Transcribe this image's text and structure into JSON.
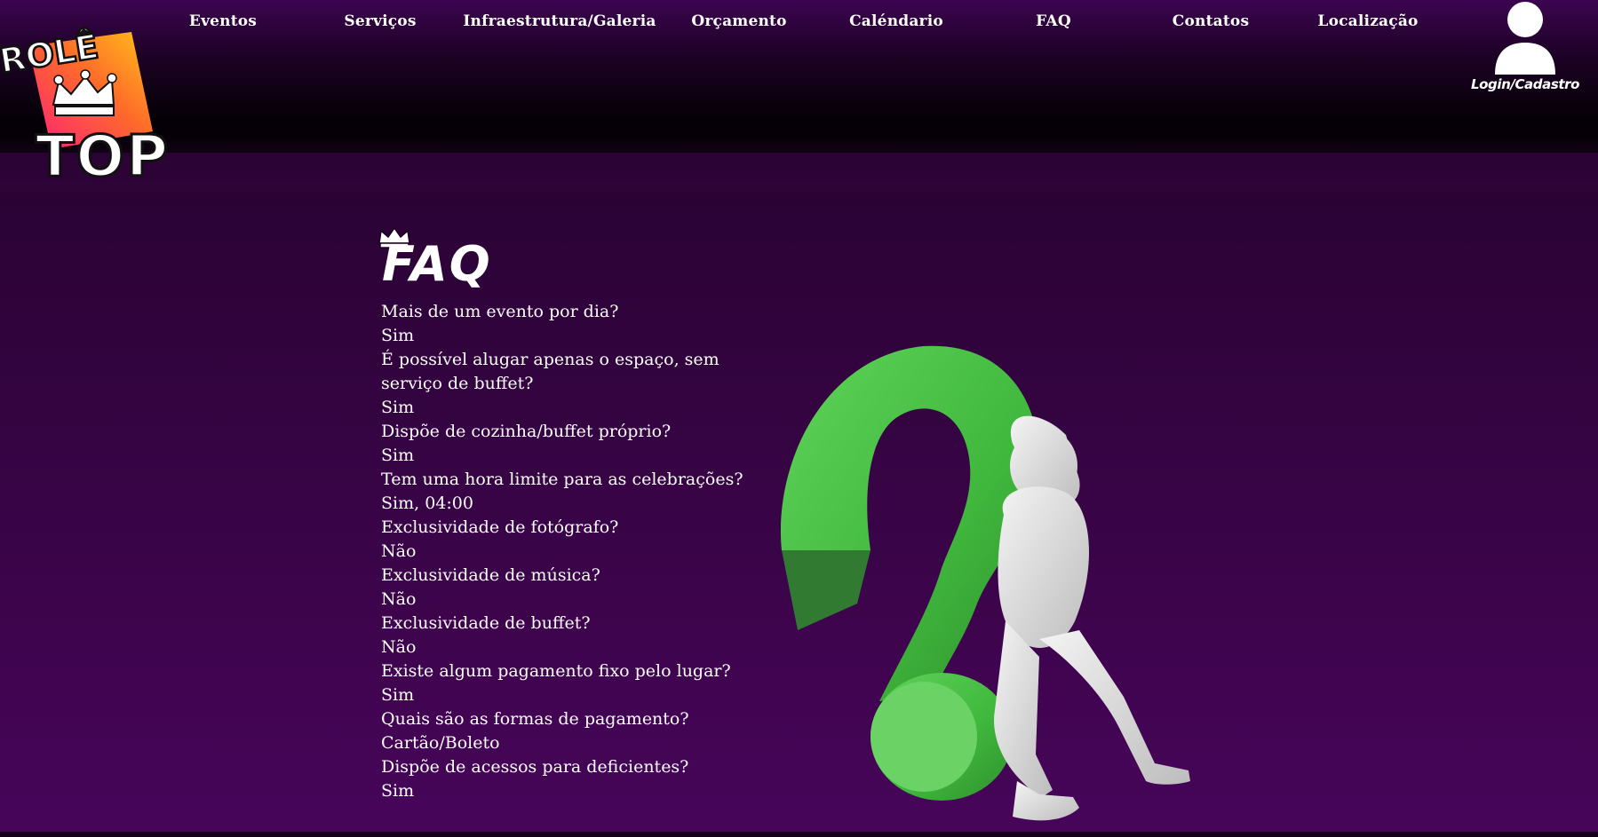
{
  "logo": {
    "line1": "ROLÊ",
    "line2": "TOP",
    "colors": {
      "gradient_start": "#ff2e6e",
      "gradient_end": "#ffc21a",
      "crown": "#ffffff",
      "text_stroke": "#111111"
    }
  },
  "nav": {
    "items": [
      {
        "label": "Eventos"
      },
      {
        "label": "Serviços"
      },
      {
        "label": "Infraestrutura/Galeria"
      },
      {
        "label": "Orçamento"
      },
      {
        "label": "Caléndario"
      },
      {
        "label": "FAQ"
      },
      {
        "label": "Contatos"
      },
      {
        "label": "Localização"
      }
    ]
  },
  "login": {
    "label": "Login/Cadastro",
    "icon": "user-icon"
  },
  "faq": {
    "heading": "FAQ",
    "icon": "crown-icon",
    "items": [
      {
        "question": "Mais de um evento por dia?",
        "answer": "Sim"
      },
      {
        "question": "É possível alugar apenas o espaço, sem serviço de buffet?",
        "answer": "Sim"
      },
      {
        "question": "Dispõe de cozinha/buffet próprio?",
        "answer": "Sim"
      },
      {
        "question": "Tem uma hora limite para as celebrações?",
        "answer": "Sim, 04:00"
      },
      {
        "question": "Exclusividade de fotógrafo?",
        "answer": "Não"
      },
      {
        "question": "Exclusividade de música?",
        "answer": "Não"
      },
      {
        "question": "Exclusividade de buffet?",
        "answer": "Não"
      },
      {
        "question": "Existe algum pagamento fixo pelo lugar?",
        "answer": "Sim"
      },
      {
        "question": "Quais são as formas de pagamento?",
        "answer": "Cartão/Boleto"
      },
      {
        "question": "Dispõe de acessos para deficientes?",
        "answer": "Sim"
      }
    ]
  },
  "illustration": {
    "icon": "question-mark-figure-illustration",
    "colors": {
      "question_mark": "#4cc44a",
      "figure": "#e4e4e4"
    }
  },
  "theme": {
    "background": "#3a0448",
    "text": "#ffffff"
  }
}
